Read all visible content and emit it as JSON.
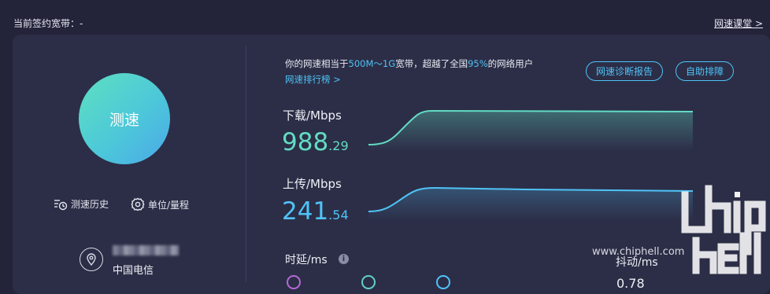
{
  "header": {
    "plan_label": "当前签约宽带：",
    "plan_value": "-",
    "class_link": "网速课堂 >"
  },
  "left": {
    "start_button": "测速",
    "history_label": "测速历史",
    "units_label": "单位/量程",
    "isp_name": "中国电信"
  },
  "summary": {
    "prefix": "你的网速相当于",
    "bandwidth": "500M～1G",
    "middle": "宽带，超越了全国",
    "percent": "95%",
    "suffix": "的网络用户",
    "ranking_link": "网速排行榜 >"
  },
  "actions": {
    "report": "网速诊断报告",
    "fix": "自助排障"
  },
  "download": {
    "label": "下载/Mbps",
    "value_int": "988",
    "value_dec": ".29",
    "value": 988.29
  },
  "upload": {
    "label": "上传/Mbps",
    "value_int": "241",
    "value_dec": ".54",
    "value": 241.54
  },
  "latency": {
    "label": "时延/ms",
    "info": "i"
  },
  "jitter": {
    "label": "抖动/ms",
    "value": "0.78"
  },
  "watermark": {
    "url": "www.chiphell.com"
  },
  "colors": {
    "background": "#23233a",
    "card": "#2c2e47",
    "accent_blue": "#4fc3f7",
    "accent_green": "#62dcc4",
    "ring_purple": "#b46ad6"
  },
  "icons": {
    "history": "history-clock-icon",
    "units": "gear-icon",
    "location": "location-pin-icon",
    "info": "info-icon"
  }
}
